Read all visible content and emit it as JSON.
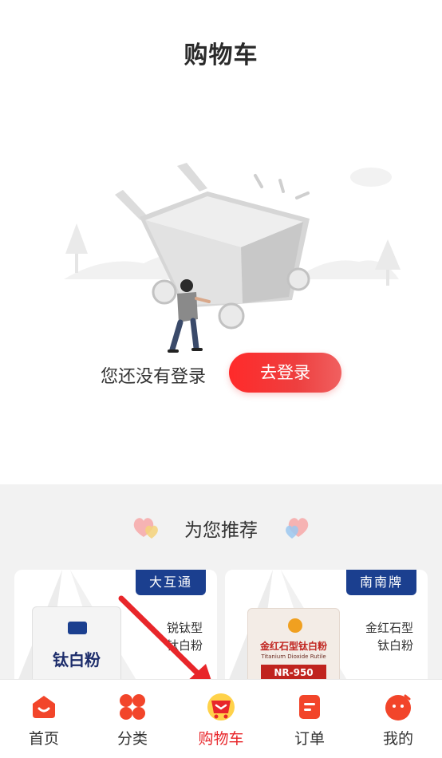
{
  "header": {
    "title": "购物车"
  },
  "empty": {
    "message": "您还没有登录",
    "login_label": "去登录"
  },
  "recommend": {
    "title": "为您推荐",
    "products": [
      {
        "brand": "大互通",
        "name_line1": "锐钛型",
        "name_line2": "钛白粉",
        "bag_text": "钛白粉"
      },
      {
        "brand": "南南牌",
        "name_line1": "金红石型",
        "name_line2": "钛白粉",
        "bag_text": "金红石型钛白粉",
        "bag_sub": "Titanium Dioxide Rutile",
        "bag_code": "NR-950"
      }
    ]
  },
  "tabbar": {
    "items": [
      {
        "label": "首页",
        "icon": "home-icon"
      },
      {
        "label": "分类",
        "icon": "category-icon"
      },
      {
        "label": "购物车",
        "icon": "cart-icon",
        "active": true
      },
      {
        "label": "订单",
        "icon": "order-icon"
      },
      {
        "label": "我的",
        "icon": "profile-icon"
      }
    ]
  },
  "colors": {
    "accent": "#e8262a",
    "brand_tag": "#1b3f8f",
    "background_recommend": "#f2f2f2"
  }
}
